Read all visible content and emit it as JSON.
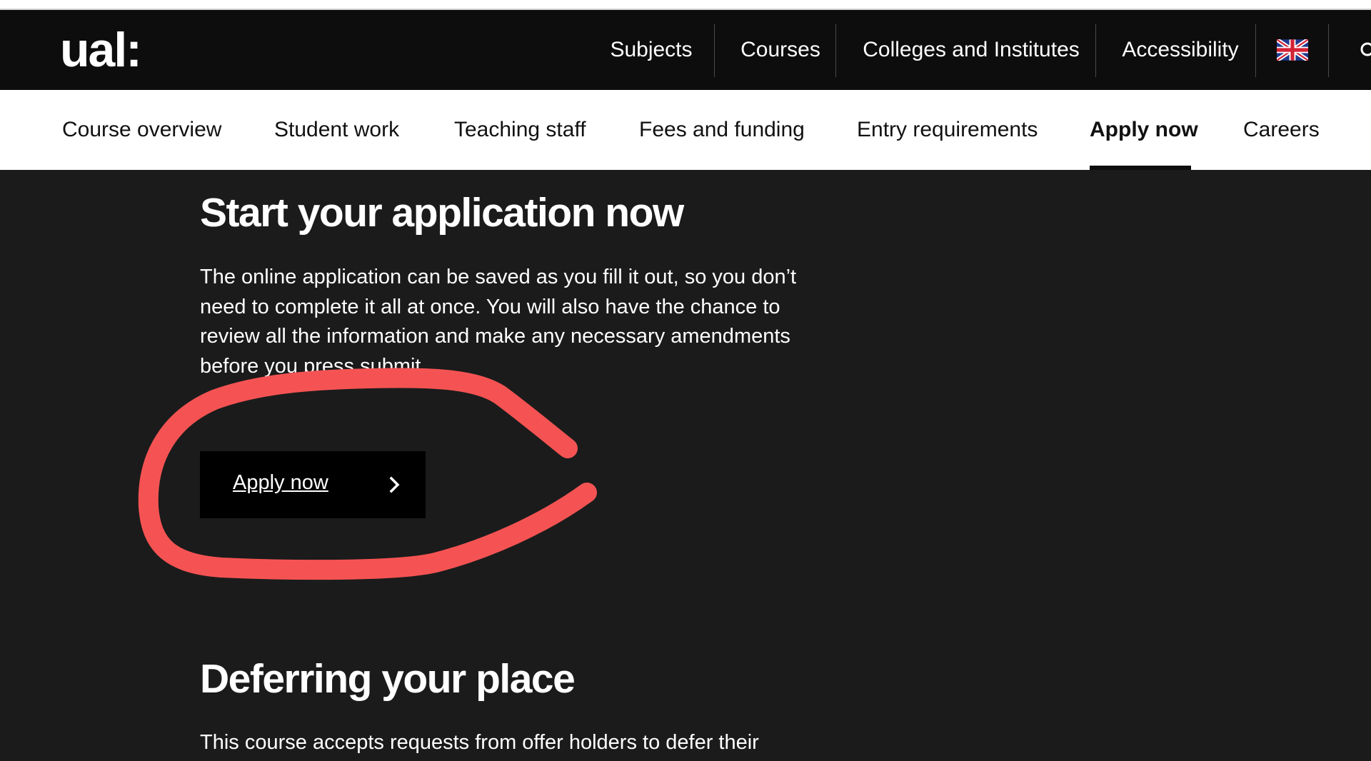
{
  "global_header": {
    "logo": "ual:",
    "nav": [
      "Subjects",
      "Courses",
      "Colleges and Institutes",
      "Accessibility"
    ],
    "language_icon": "uk-flag-icon",
    "search_icon": "search-icon"
  },
  "course_nav": {
    "items": [
      "Course overview",
      "Student work",
      "Teaching staff",
      "Fees and funding",
      "Entry requirements",
      "Apply now",
      "Careers"
    ],
    "active": "Apply now"
  },
  "main": {
    "heading": "Start your application now",
    "paragraph": "The online application can be saved as you fill it out, so you don’t need to complete it all at once. You will also have the chance to review all the information and make any necessary amendments before you press submit.",
    "apply_button": "Apply now",
    "section2_heading": "Deferring your place",
    "section2_paragraph": "This course accepts requests from offer holders to defer their"
  },
  "colors": {
    "header_bg": "#0d0d0d",
    "page_bg": "#1b1b1b",
    "annotation": "#f55353"
  }
}
